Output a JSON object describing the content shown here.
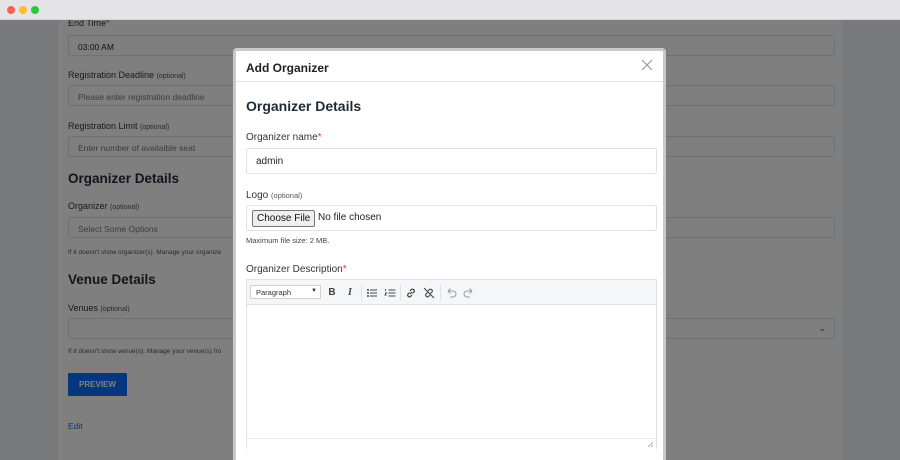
{
  "background_form": {
    "end_time": {
      "label": "End Time",
      "required_mark": "*",
      "value": "03:00 AM"
    },
    "registration_deadline": {
      "label": "Registration Deadline",
      "optional": "(optional)",
      "placeholder": "Please enter registration deadline"
    },
    "registration_limit": {
      "label": "Registration Limit",
      "optional": "(optional)",
      "placeholder": "Enter number of availalble seat"
    },
    "organizer_heading": "Organizer Details",
    "organizer": {
      "label": "Organizer",
      "optional": "(optional)",
      "placeholder": "Select Some Options",
      "help": "If it doesn't show organizer(s). Manage your organize"
    },
    "venue_heading": "Venue Details",
    "venues": {
      "label": "Venues",
      "optional": "(optional)",
      "help": "If it doesn't show venue(s). Manage your venue(s) fro"
    },
    "preview_label": "PREVIEW",
    "edit_label": "Edit"
  },
  "modal": {
    "title": "Add Organizer",
    "close_icon": "close-icon",
    "section_heading": "Organizer Details",
    "organizer_name": {
      "label": "Organizer name",
      "required_mark": "*",
      "value": "admin"
    },
    "logo": {
      "label": "Logo",
      "optional": "(optional)",
      "button_label": "Choose File",
      "status": "No file chosen",
      "help": "Maximum file size: 2 MB."
    },
    "description": {
      "label": "Organizer Description",
      "required_mark": "*",
      "toolbar": {
        "format_select": "Paragraph",
        "bold": "B",
        "italic": "I",
        "icons": [
          "bulleted-list-icon",
          "numbered-list-icon",
          "link-icon",
          "unlink-icon",
          "undo-icon",
          "redo-icon"
        ]
      }
    }
  }
}
